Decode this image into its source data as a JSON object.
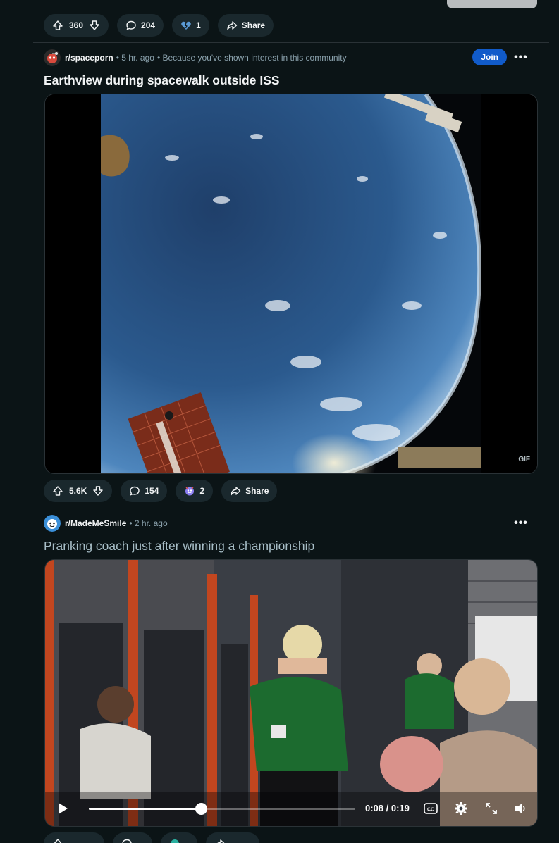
{
  "top_post": {
    "votes": "360",
    "comments": "204",
    "award_count": "1",
    "share_label": "Share"
  },
  "post1": {
    "subreddit": "r/spaceporn",
    "time": "• 5 hr. ago",
    "reason": "• Because you've shown interest in this community",
    "join_label": "Join",
    "more_label": "•••",
    "title": "Earthview during spacewalk outside ISS",
    "media_badge": "GIF",
    "votes": "5.6K",
    "comments": "154",
    "award_count": "2",
    "share_label": "Share"
  },
  "post2": {
    "subreddit": "r/MadeMeSmile",
    "time": "• 2 hr. ago",
    "more_label": "•••",
    "title": "Pranking coach just after winning a championship",
    "video_time": "0:08 / 0:19",
    "progress_fraction": 0.42
  },
  "colors": {
    "background": "#0b1416",
    "pill": "#1a282d",
    "join": "#115bca",
    "text_primary": "#f2f4f5",
    "text_meta": "#8ba2ad",
    "title_visited": "#a7bdc6"
  },
  "icons": {
    "upvote": "arrow-up-icon",
    "downvote": "arrow-down-icon",
    "comment": "comment-bubble-icon",
    "share": "share-arrow-icon",
    "award": "award-icon",
    "play": "play-icon",
    "captions": "captions-icon",
    "settings": "gear-icon",
    "fullscreen": "expand-icon",
    "volume": "volume-icon"
  }
}
